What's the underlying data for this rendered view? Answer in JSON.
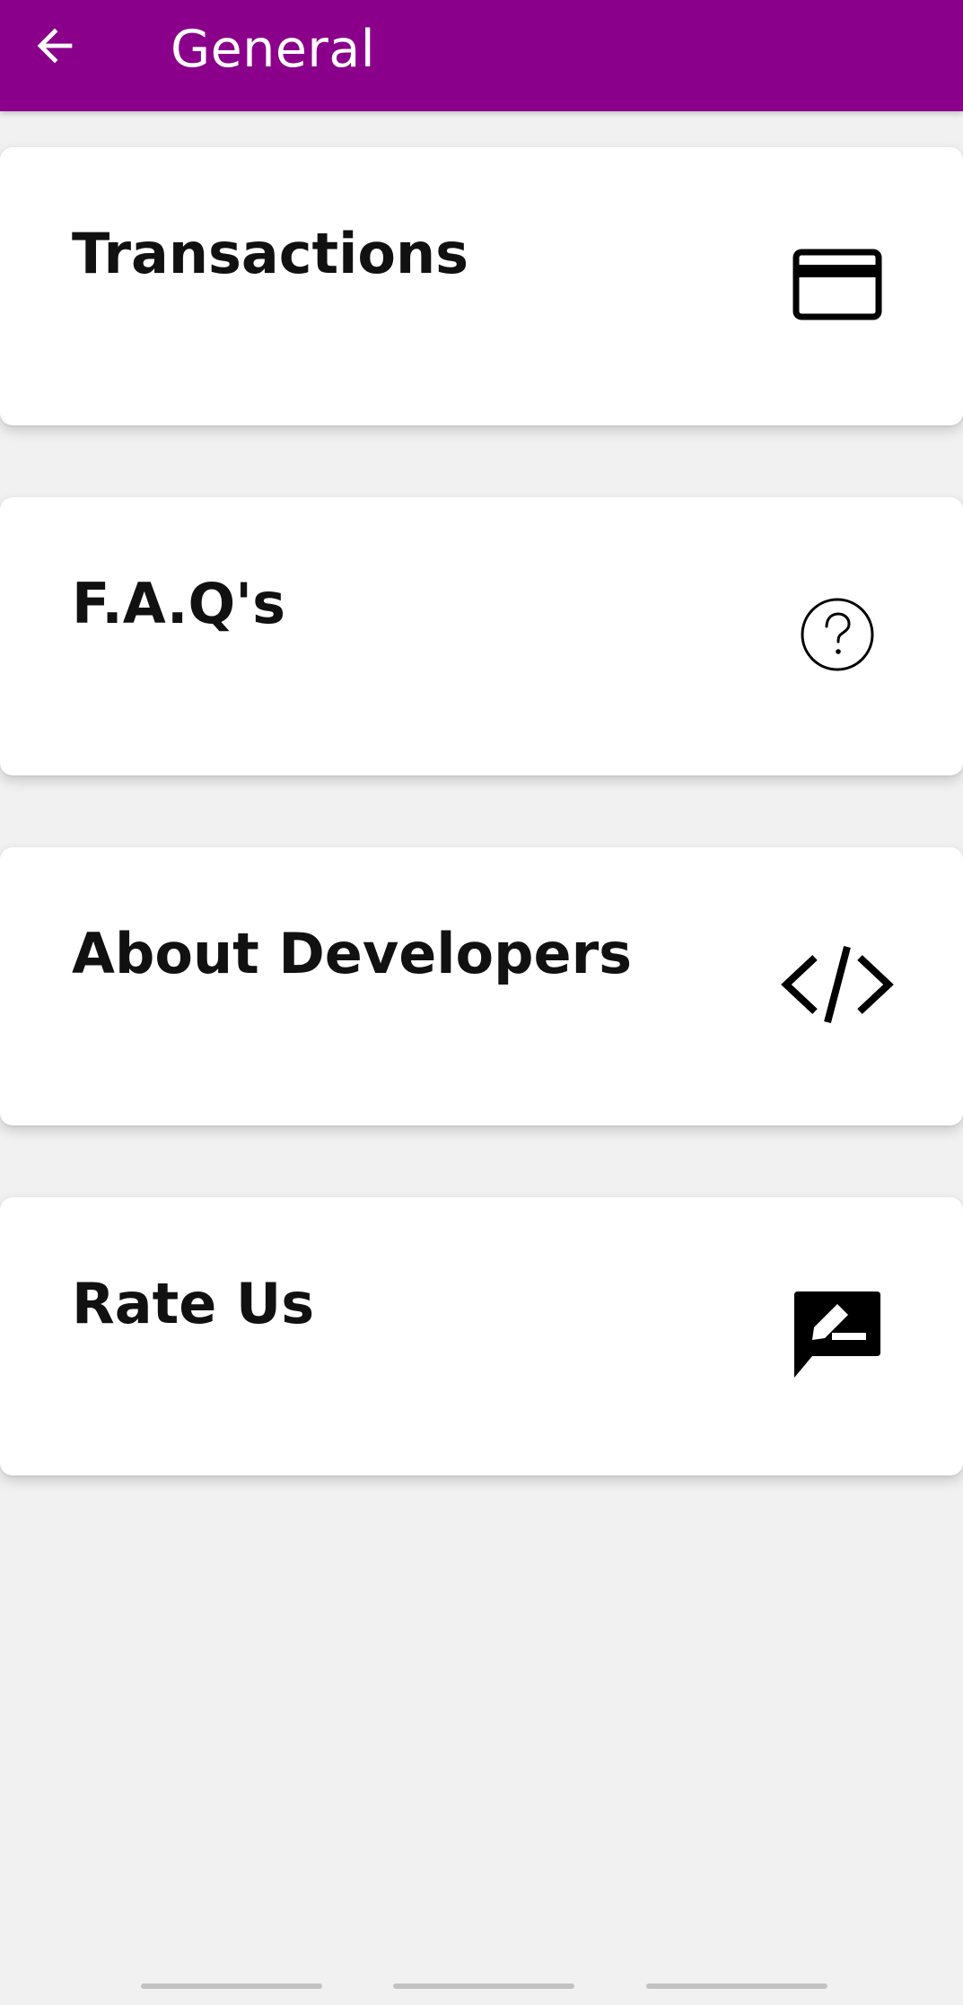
{
  "header": {
    "title": "General",
    "back_icon": "arrow-left-icon",
    "background_color": "#8b008b"
  },
  "menu": {
    "items": [
      {
        "label": "Transactions",
        "icon": "credit-card-icon"
      },
      {
        "label": "F.A.Q's",
        "icon": "help-circle-icon"
      },
      {
        "label": "About Developers",
        "icon": "code-icon"
      },
      {
        "label": "Rate Us",
        "icon": "rate-review-icon"
      }
    ]
  }
}
